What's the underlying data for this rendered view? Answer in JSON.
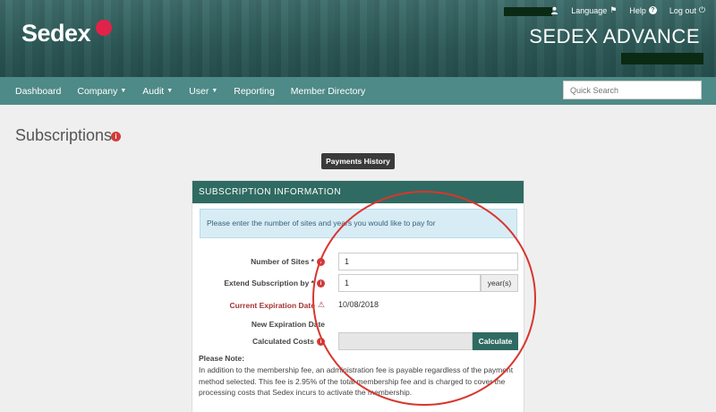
{
  "header": {
    "logo_text": "Sedex",
    "brand_title": "SEDEX ADVANCE",
    "links": {
      "language": "Language",
      "help": "Help",
      "logout": "Log out"
    }
  },
  "nav": {
    "items": [
      {
        "label": "Dashboard",
        "caret": false
      },
      {
        "label": "Company",
        "caret": true
      },
      {
        "label": "Audit",
        "caret": true
      },
      {
        "label": "User",
        "caret": true
      },
      {
        "label": "Reporting",
        "caret": false
      },
      {
        "label": "Member Directory",
        "caret": false
      }
    ],
    "search_placeholder": "Quick Search"
  },
  "page": {
    "title": "Subscriptions",
    "payments_history_label": "Payments History"
  },
  "panel": {
    "title": "SUBSCRIPTION INFORMATION",
    "notice": "Please enter the number of sites and years you would like to pay for",
    "number_of_sites_label": "Number of Sites *",
    "number_of_sites_value": "1",
    "extend_label": "Extend Subscription by *",
    "extend_value": "1",
    "extend_unit": "year(s)",
    "current_expiration_label": "Current Expiration Date",
    "current_expiration_value": "10/08/2018",
    "new_expiration_label": "New Expiration Date",
    "calculated_costs_label": "Calculated Costs",
    "calculate_button": "Calculate",
    "note_title": "Please Note:",
    "note_text": "In addition to the membership fee, an administration fee is payable regardless of the payment method selected. This fee is 2.95% of the total membership fee and is charged to cover the processing costs that Sedex incurs to activate the membership."
  },
  "colors": {
    "header_bg": "#2f5e5c",
    "nav_bg": "#4e8a87",
    "panel_header": "#2f6b62",
    "accent_red": "#d9352e",
    "logo_dot": "#e0234a"
  },
  "icons": [
    "user-icon",
    "flag-icon",
    "help-icon",
    "logout-icon",
    "info-icon",
    "warning-icon"
  ]
}
